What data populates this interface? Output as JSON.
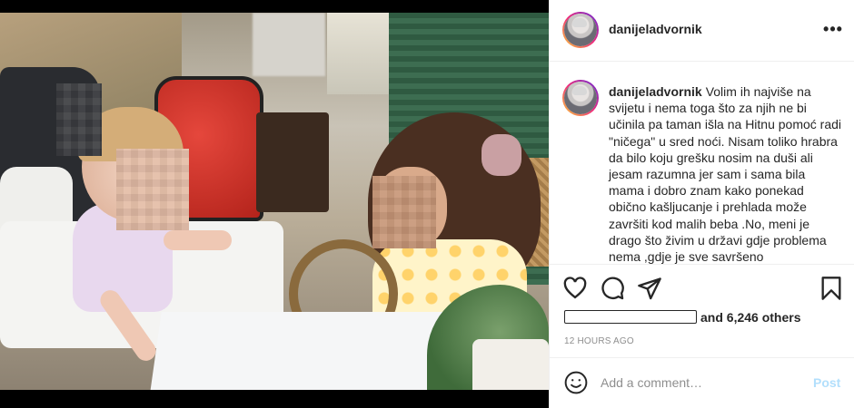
{
  "post": {
    "username": "danijeladvornik",
    "caption_user": "danijeladvornik",
    "caption_text": "Volim ih najviše na svijetu i nema toga što za njih ne bi učinila pa taman išla na Hitnu pomoć radi \"ničega\" u sred noći. Nisam toliko hrabra da bilo koju grešku nosim na duši ali jesam razumna jer sam i sama bila mama i dobro znam kako ponekad obično kašljucanje i prehlada može završiti kod malih beba .No, meni je drago što živim u državi gdje problema nema ,gdje je sve savršeno",
    "likes_text": "and 6,246 others",
    "timestamp": "12 HOURS AGO",
    "more_label": "•••"
  },
  "comment_box": {
    "placeholder": "Add a comment…",
    "post_label": "Post"
  },
  "icons": {
    "like": "heart-icon",
    "comment": "comment-bubble-icon",
    "share": "paper-plane-icon",
    "save": "bookmark-icon",
    "emoji": "smiley-icon",
    "more": "more-dots-icon"
  },
  "colors": {
    "text": "#262626",
    "muted": "#8e8e8e",
    "post_disabled": "#b2dffc",
    "border": "#efefef"
  }
}
